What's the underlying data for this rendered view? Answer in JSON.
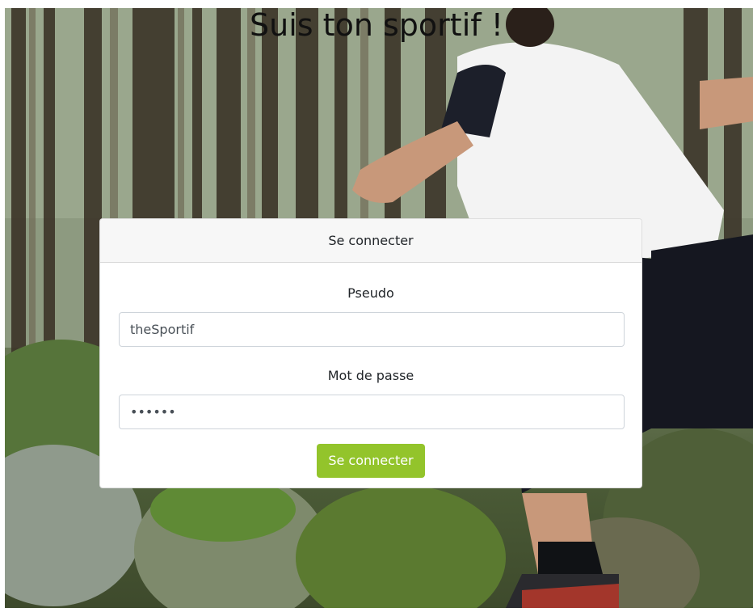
{
  "page": {
    "title": "Suis ton sportif !"
  },
  "login_card": {
    "header": "Se connecter",
    "username_label": "Pseudo",
    "username_value": "theSportif",
    "password_label": "Mot de passe",
    "password_value": "••••••",
    "submit_label": "Se connecter"
  },
  "colors": {
    "submit_button": "#93c42b",
    "card_header_bg": "#f7f7f7"
  }
}
